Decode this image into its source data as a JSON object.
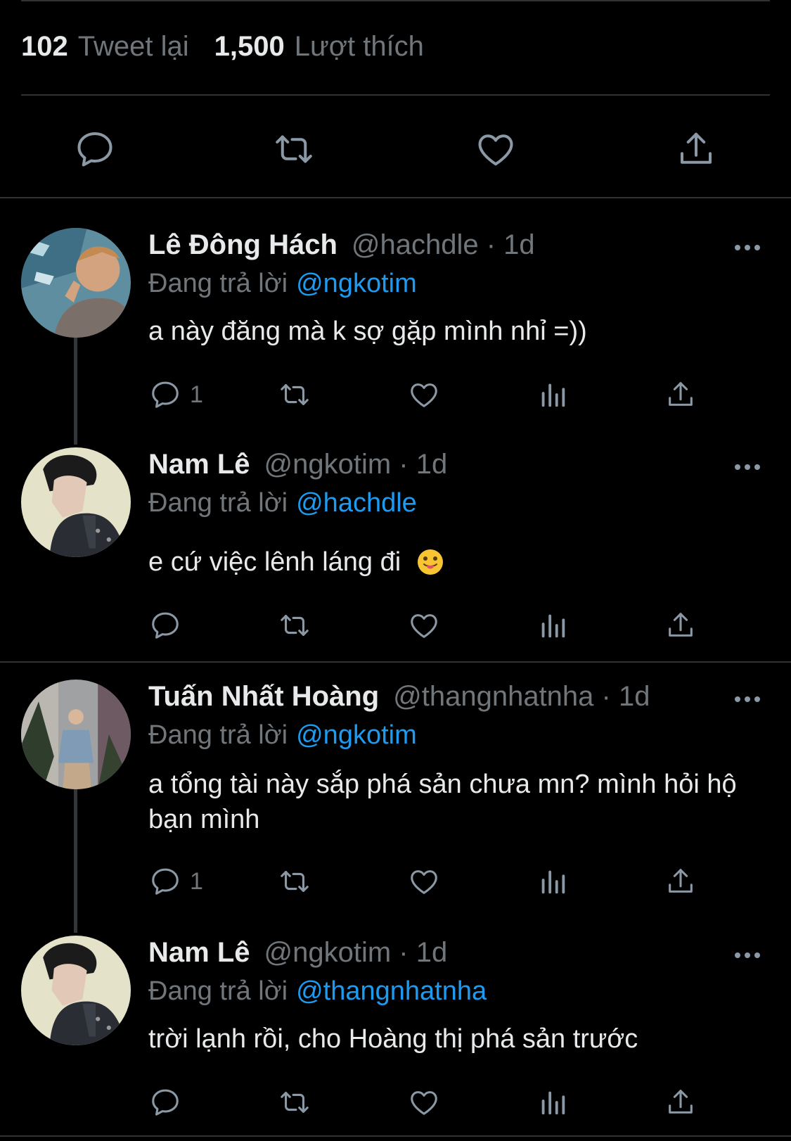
{
  "stats": {
    "retweets_count": "102",
    "retweets_label": "Tweet lại",
    "likes_count": "1,500",
    "likes_label": "Lượt thích"
  },
  "main_actions": [
    "reply-icon",
    "retweet-icon",
    "like-icon",
    "share-icon"
  ],
  "colors": {
    "background": "#000000",
    "text": "#e7e9ea",
    "muted": "#71767b",
    "accent": "#1d9bf0",
    "divider": "#2f3336"
  },
  "replies": [
    {
      "name": "Lê Đông Hách",
      "handle": "@hachdle · 1d",
      "replying_label": "Đang trả lời",
      "replying_to": "@ngkotim",
      "text": "a này đăng mà k sợ gặp mình nhỉ =))",
      "reply_count": "1"
    },
    {
      "name": "Nam Lê",
      "handle": "@ngkotim · 1d",
      "replying_label": "Đang trả lời",
      "replying_to": "@hachdle",
      "text": "e cứ việc lênh láng đi",
      "emoji": "face-with-tongue-emoji",
      "reply_count": ""
    },
    {
      "name": "Tuấn Nhất Hoàng",
      "handle": "@thangnhatnha · 1d",
      "replying_label": "Đang trả lời",
      "replying_to": "@ngkotim",
      "text": "a tổng tài này sắp phá sản chưa mn? mình hỏi hộ bạn mình",
      "reply_count": "1"
    },
    {
      "name": "Nam Lê",
      "handle": "@ngkotim · 1d",
      "replying_label": "Đang trả lời",
      "replying_to": "@thangnhatnha",
      "text": "trời lạnh rồi, cho Hoàng thị phá sản trước",
      "reply_count": ""
    }
  ]
}
